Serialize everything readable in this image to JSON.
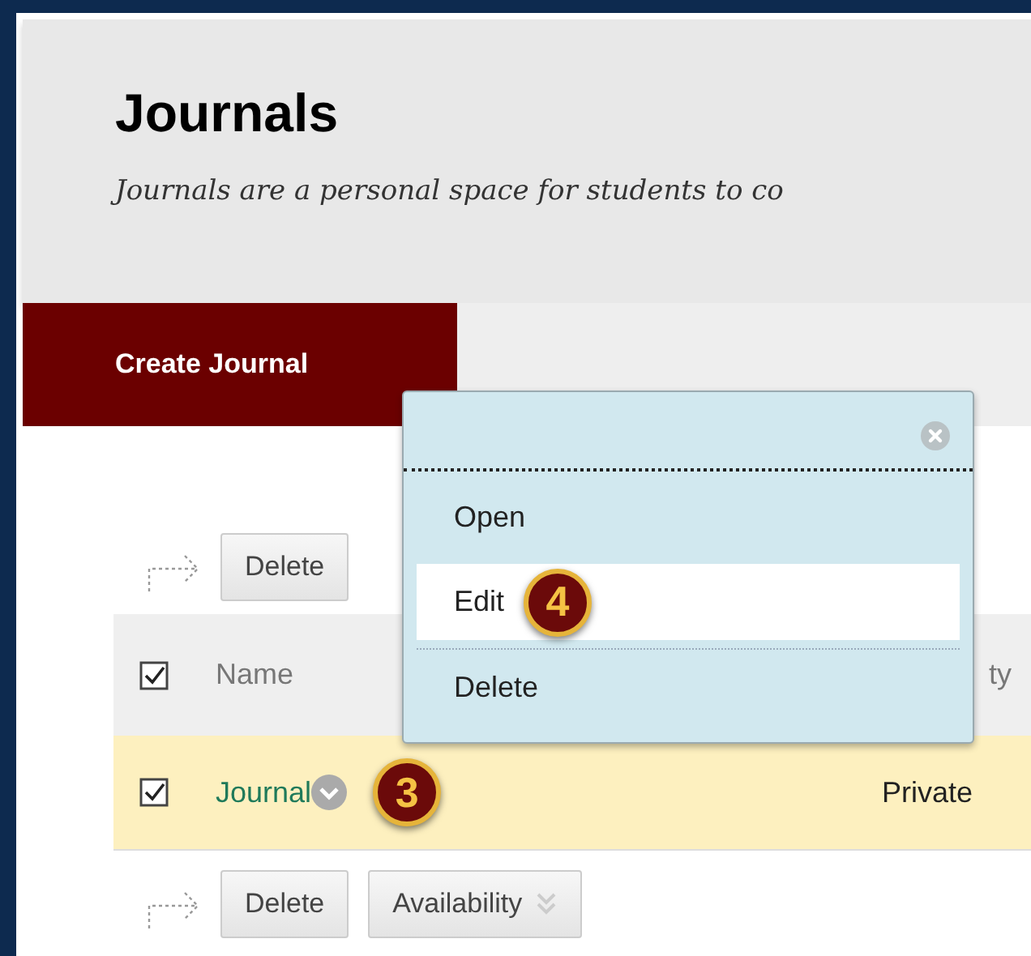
{
  "header": {
    "title": "Journals",
    "description": "Journals are a personal space for students to co"
  },
  "tabs": [
    {
      "label": "Create Journal",
      "selected": true
    }
  ],
  "top_toolbar": {
    "buttons": [
      {
        "label": "Delete"
      }
    ]
  },
  "table": {
    "select_all_checked": true,
    "columns": [
      "Name",
      "ty"
    ],
    "rows": [
      {
        "name": "Journal",
        "column_2": "Private",
        "checked": true,
        "callout": "3"
      }
    ]
  },
  "bottom_toolbar": {
    "buttons": [
      {
        "label": "Delete",
        "kind": "plain"
      },
      {
        "label": "Availability",
        "kind": "dropdown"
      }
    ]
  },
  "context_menu": {
    "items": [
      {
        "label": "Open",
        "selected": false
      },
      {
        "label": "Edit",
        "selected": true,
        "callout": "4"
      },
      {
        "label": "Delete",
        "selected": false
      }
    ]
  }
}
